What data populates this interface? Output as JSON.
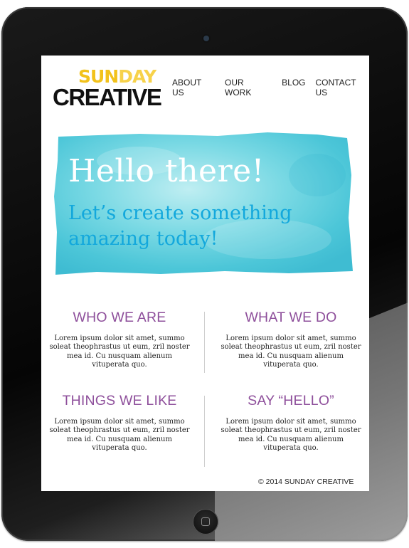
{
  "brand": {
    "logo_top_1": "SUN",
    "logo_top_2": "DAY",
    "logo_bottom": "CREATIVE"
  },
  "nav": {
    "items": [
      "ABOUT US",
      "OUR WORK",
      "BLOG",
      "CONTACT US"
    ]
  },
  "hero": {
    "title": "Hello there!",
    "subtitle": "Let’s create something amazing today!"
  },
  "sections": [
    {
      "title": "WHO WE ARE",
      "body": "Lorem ipsum dolor sit amet, summo soleat theophrastus ut eum, zril noster mea id. Cu nusquam alienum vituperata quo."
    },
    {
      "title": "WHAT WE DO",
      "body": "Lorem ipsum dolor sit amet, summo soleat theophrastus ut eum, zril noster mea id. Cu nusquam alienum vituperata quo."
    },
    {
      "title": "THINGS WE LIKE",
      "body": "Lorem ipsum dolor sit amet, summo soleat theophrastus ut eum, zril noster mea id. Cu nusquam alienum vituperata quo."
    },
    {
      "title": "SAY “HELLO”",
      "body": "Lorem ipsum dolor sit amet, summo soleat theophrastus ut eum, zril noster mea id. Cu nusquam alienum vituperata quo."
    }
  ],
  "footer": {
    "copyright": "© 2014 SUNDAY CREATIVE"
  },
  "colors": {
    "accent_purple": "#8e4f9b",
    "hero_blue": "#13a8dc",
    "watercolor": "#5fd0dc",
    "logo_yellow": "#f2c21b"
  }
}
